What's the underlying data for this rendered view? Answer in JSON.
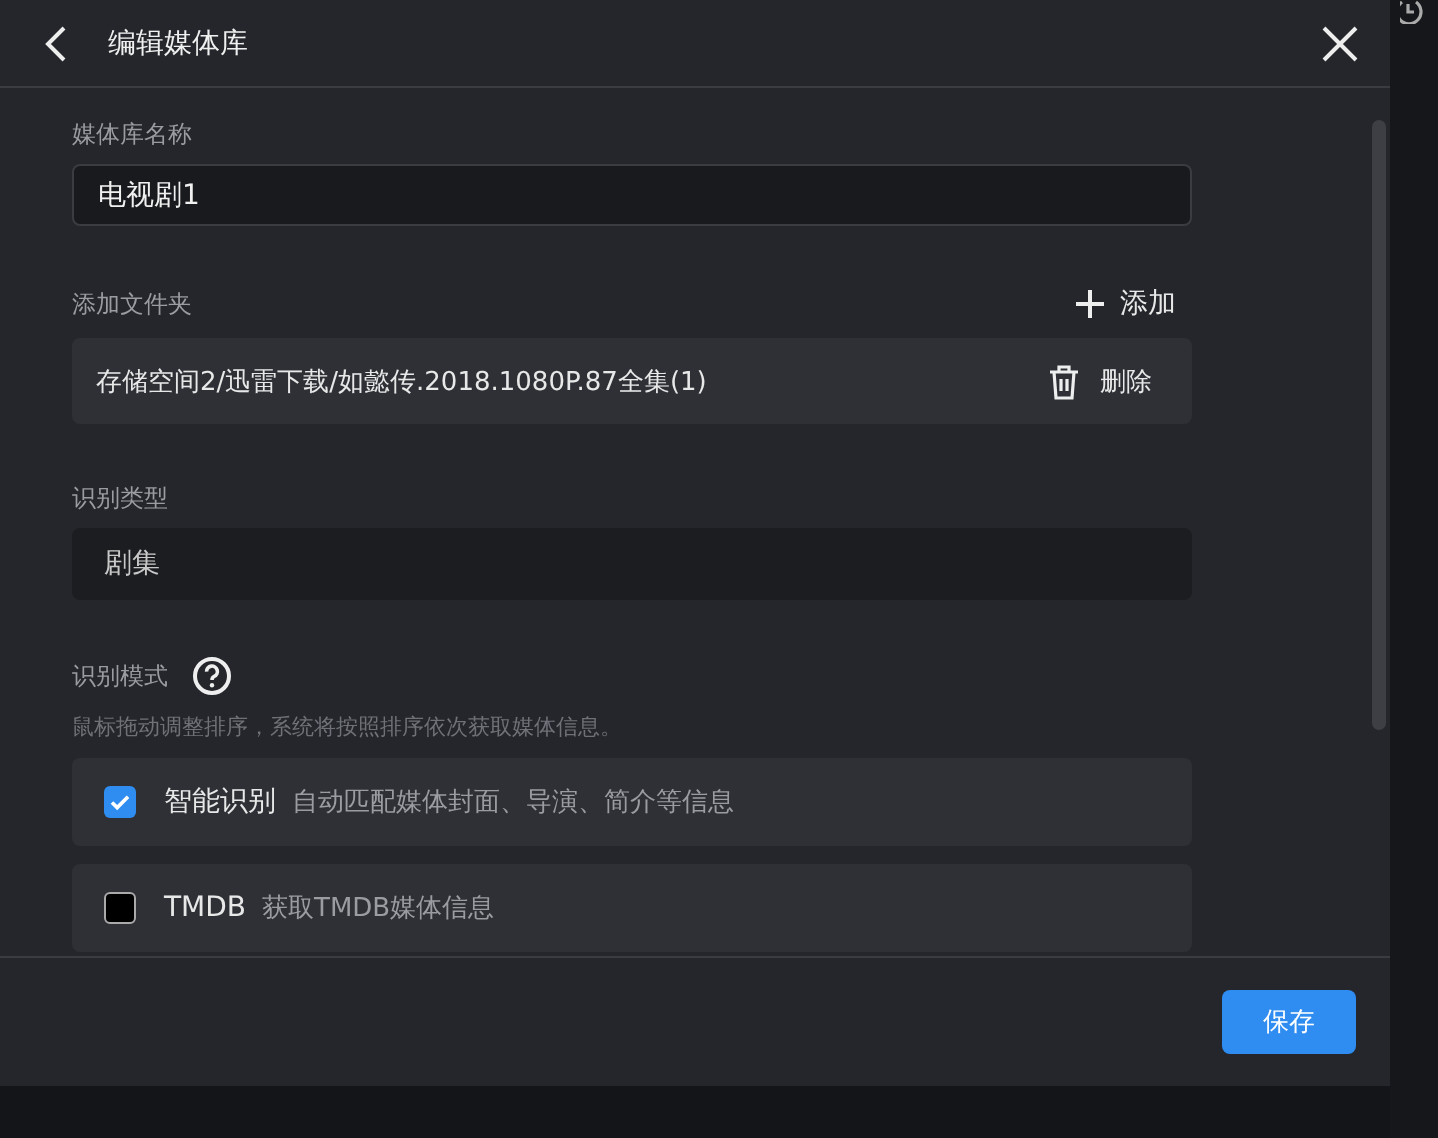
{
  "dialog": {
    "title": "编辑媒体库",
    "name_field": {
      "label": "媒体库名称",
      "value": "电视剧1"
    },
    "folders": {
      "label": "添加文件夹",
      "add_button": "添加",
      "items": [
        {
          "path": "存储空间2/迅雷下载/如懿传.2018.1080P.87全集(1)",
          "delete_button": "删除"
        }
      ]
    },
    "type_field": {
      "label": "识别类型",
      "value": "剧集"
    },
    "mode": {
      "label": "识别模式",
      "hint": "鼠标拖动调整排序，系统将按照排序依次获取媒体信息。",
      "options": [
        {
          "name": "智能识别",
          "description": "自动匹配媒体封面、导演、简介等信息",
          "checked": true
        },
        {
          "name": "TMDB",
          "description": "获取TMDB媒体信息",
          "checked": false
        }
      ]
    },
    "save_button": "保存"
  }
}
